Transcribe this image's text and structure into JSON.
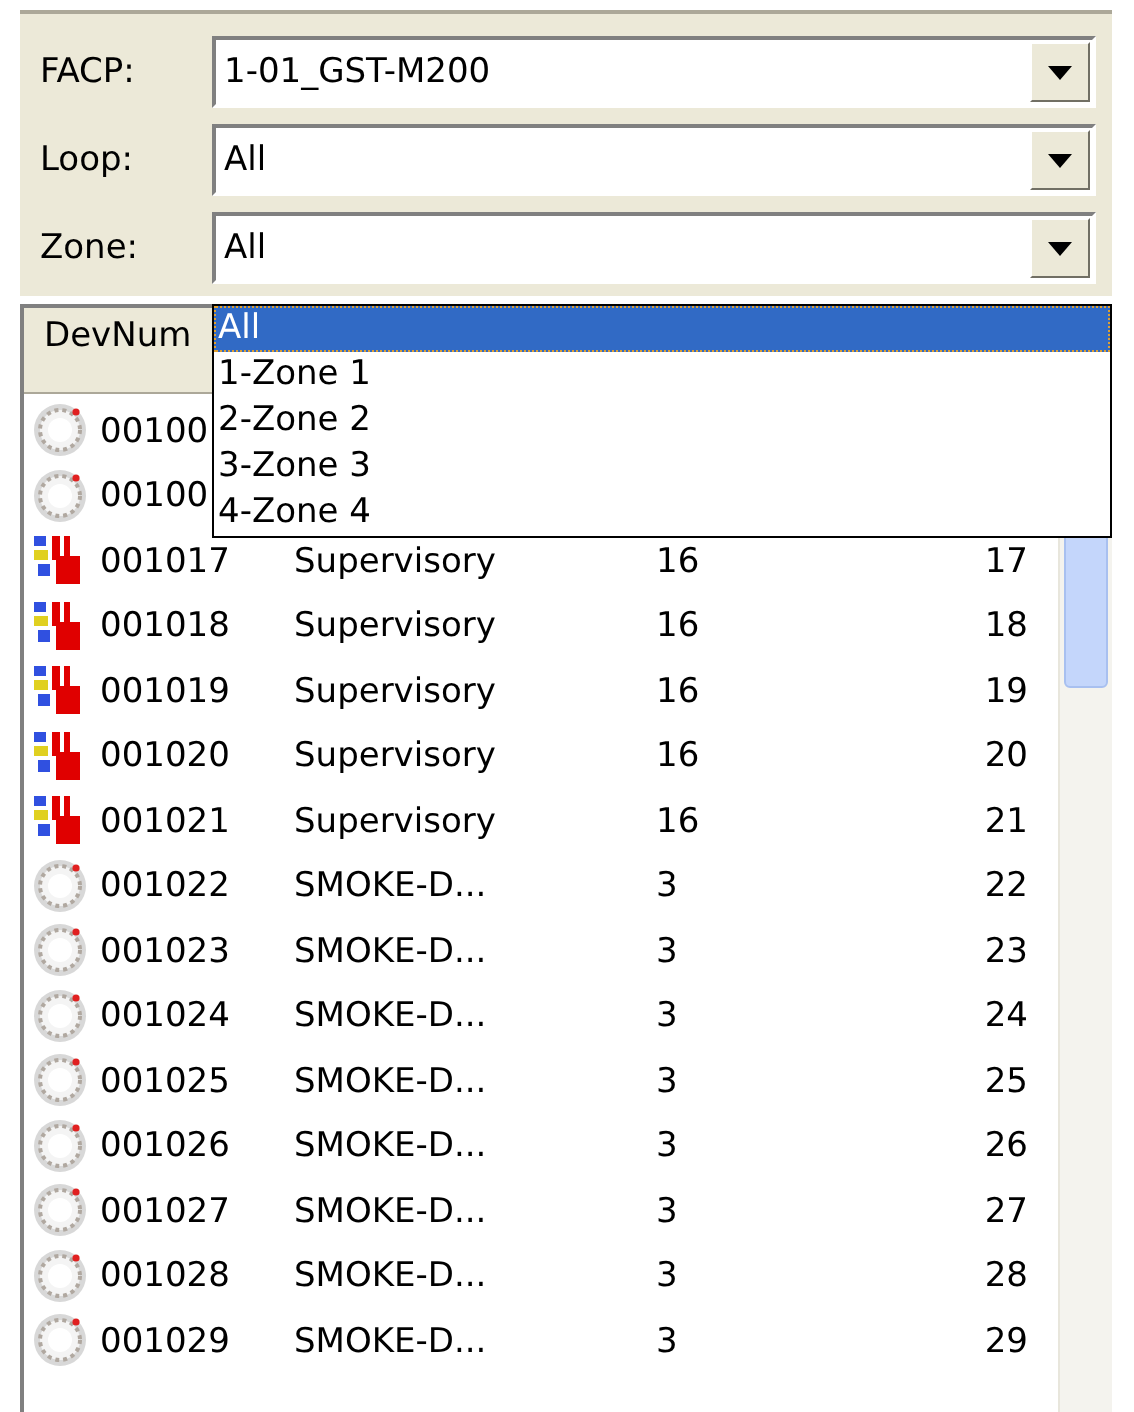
{
  "filters": [
    {
      "label": "FACP:",
      "value": "1-01_GST-M200"
    },
    {
      "label": "Loop:",
      "value": "All"
    },
    {
      "label": "Zone:",
      "value": "All"
    }
  ],
  "zone_dropdown": {
    "options": [
      {
        "label": "All",
        "selected": true
      },
      {
        "label": "1-Zone 1",
        "selected": false
      },
      {
        "label": "2-Zone 2",
        "selected": false
      },
      {
        "label": "3-Zone 3",
        "selected": false
      },
      {
        "label": "4-Zone 4",
        "selected": false
      }
    ]
  },
  "table": {
    "columns": [
      "DevNum"
    ],
    "rows": [
      {
        "kind": "smoke-detector",
        "cells": [
          "00100"
        ]
      },
      {
        "kind": "smoke-detector",
        "cells": [
          "00100"
        ]
      },
      {
        "kind": "supervisory",
        "cells": [
          "001017",
          "Supervisory",
          "16",
          "17"
        ]
      },
      {
        "kind": "supervisory",
        "cells": [
          "001018",
          "Supervisory",
          "16",
          "18"
        ]
      },
      {
        "kind": "supervisory",
        "cells": [
          "001019",
          "Supervisory",
          "16",
          "19"
        ]
      },
      {
        "kind": "supervisory",
        "cells": [
          "001020",
          "Supervisory",
          "16",
          "20"
        ]
      },
      {
        "kind": "supervisory",
        "cells": [
          "001021",
          "Supervisory",
          "16",
          "21"
        ]
      },
      {
        "kind": "smoke-detector",
        "cells": [
          "001022",
          "SMOKE-D...",
          "3",
          "22"
        ]
      },
      {
        "kind": "smoke-detector",
        "cells": [
          "001023",
          "SMOKE-D...",
          "3",
          "23"
        ]
      },
      {
        "kind": "smoke-detector",
        "cells": [
          "001024",
          "SMOKE-D...",
          "3",
          "24"
        ]
      },
      {
        "kind": "smoke-detector",
        "cells": [
          "001025",
          "SMOKE-D...",
          "3",
          "25"
        ]
      },
      {
        "kind": "smoke-detector",
        "cells": [
          "001026",
          "SMOKE-D...",
          "3",
          "26"
        ]
      },
      {
        "kind": "smoke-detector",
        "cells": [
          "001027",
          "SMOKE-D...",
          "3",
          "27"
        ]
      },
      {
        "kind": "smoke-detector",
        "cells": [
          "001028",
          "SMOKE-D...",
          "3",
          "28"
        ]
      },
      {
        "kind": "smoke-detector",
        "cells": [
          "001029",
          "SMOKE-D...",
          "3",
          "29"
        ]
      }
    ]
  }
}
